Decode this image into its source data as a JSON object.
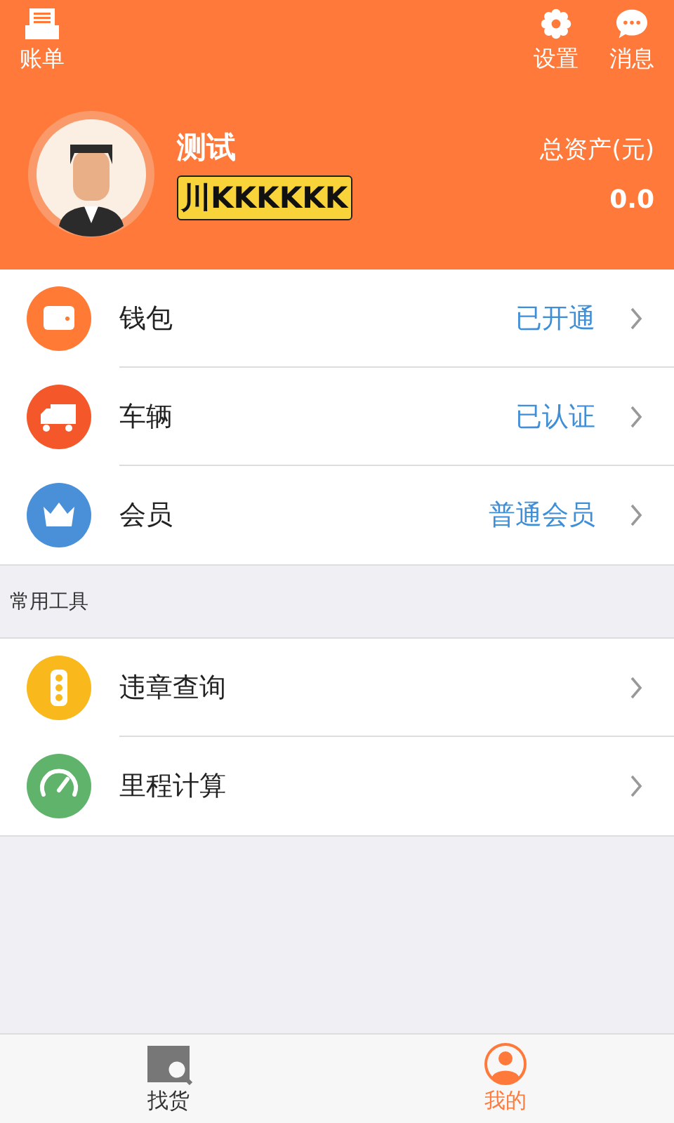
{
  "header": {
    "left_action": {
      "label": "账单",
      "kind": "bill"
    },
    "right_actions": [
      {
        "label": "设置",
        "kind": "settings"
      },
      {
        "label": "消息",
        "kind": "message"
      }
    ],
    "user_name": "测试",
    "plate": "川KKKKKK",
    "assets_label": "总资产(元)",
    "assets_value": "0.0"
  },
  "account_items": [
    {
      "label": "钱包",
      "status": "已开通",
      "kind": "wallet",
      "color": "#ff7a35"
    },
    {
      "label": "车辆",
      "status": "已认证",
      "kind": "truck",
      "color": "#f4582a"
    },
    {
      "label": "会员",
      "status": "普通会员",
      "kind": "crown",
      "color": "#4a90d9"
    }
  ],
  "tools_section": {
    "title": "常用工具",
    "items": [
      {
        "label": "违章查询",
        "kind": "traffic-light",
        "color": "#f9b81b"
      },
      {
        "label": "里程计算",
        "kind": "gauge",
        "color": "#5fb36a"
      }
    ]
  },
  "tab_bar": [
    {
      "label": "找货",
      "kind": "search-box",
      "selected": false
    },
    {
      "label": "我的",
      "kind": "person",
      "selected": true
    }
  ]
}
